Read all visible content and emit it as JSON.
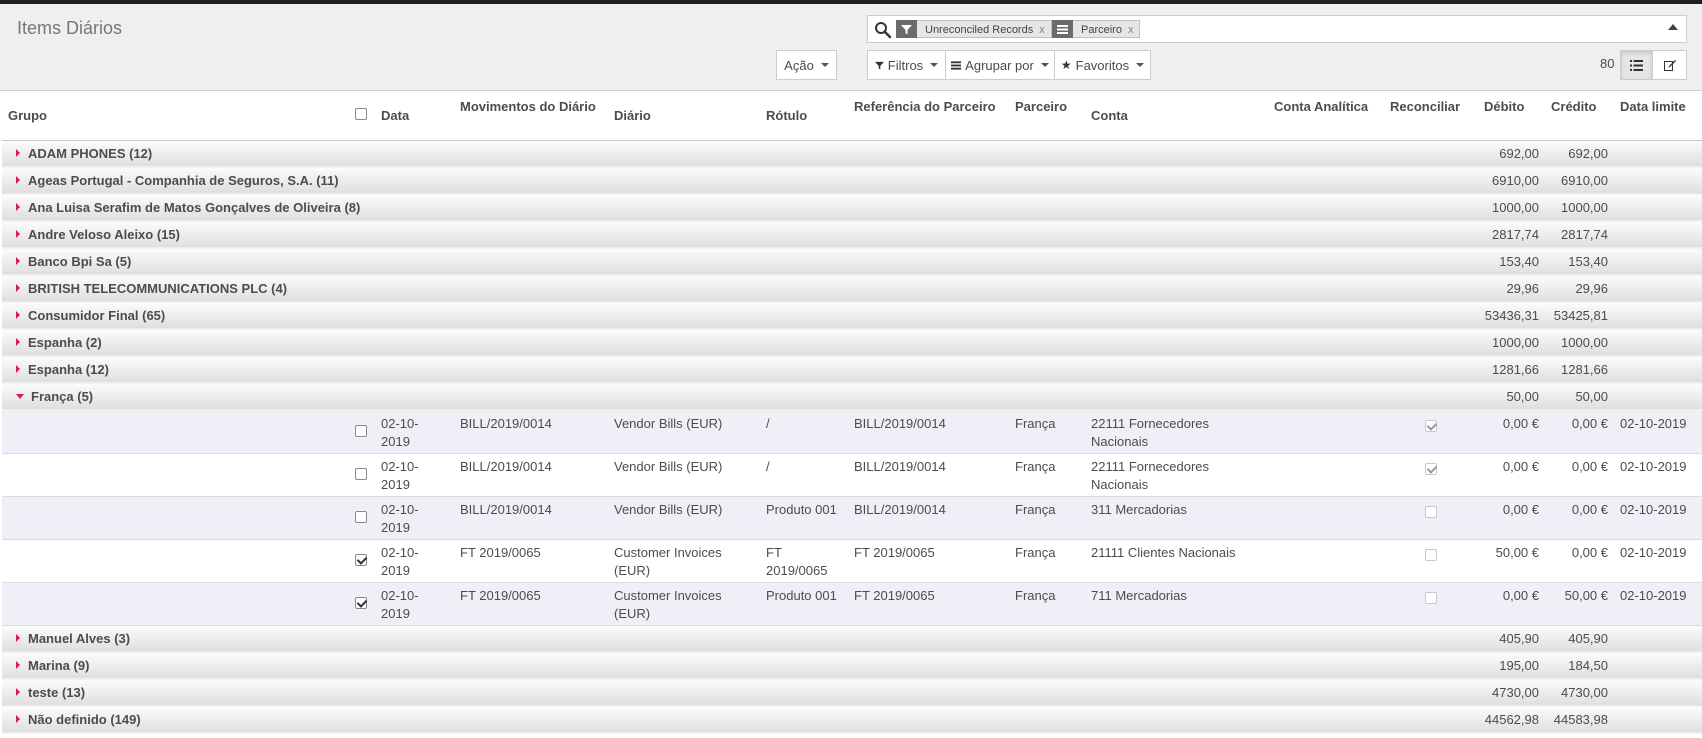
{
  "header": {
    "title": "Items Diários",
    "search": {
      "facets": [
        {
          "icon": "filter-icon",
          "value": "Unreconciled Records",
          "remove": "x"
        },
        {
          "icon": "group-by-icon",
          "value": "Parceiro",
          "remove": "x"
        }
      ]
    },
    "action_label": "Ação",
    "filters_label": "Filtros",
    "groupby_label": "Agrupar por",
    "favorites_label": "Favoritos",
    "pager_value": "80",
    "views": [
      "list-view-icon",
      "form-view-icon"
    ]
  },
  "table": {
    "columns": [
      "Grupo",
      "Data",
      "Movimentos do Diário",
      "Diário",
      "Rótulo",
      "Referência do Parceiro",
      "Parceiro",
      "Conta",
      "Conta Analítica",
      "Reconciliar",
      "Débito",
      "Crédito",
      "Data limite"
    ],
    "groups_before": [
      {
        "name": "ADAM PHONES (12)",
        "debit": "692,00",
        "credit": "692,00"
      },
      {
        "name": "Ageas Portugal - Companhia de Seguros, S.A. (11)",
        "debit": "6910,00",
        "credit": "6910,00"
      },
      {
        "name": "Ana Luisa Serafim de Matos Gonçalves de Oliveira (8)",
        "debit": "1000,00",
        "credit": "1000,00"
      },
      {
        "name": "Andre Veloso Aleixo (15)",
        "debit": "2817,74",
        "credit": "2817,74"
      },
      {
        "name": "Banco Bpi Sa (5)",
        "debit": "153,40",
        "credit": "153,40"
      },
      {
        "name": "BRITISH TELECOMMUNICATIONS PLC (4)",
        "debit": "29,96",
        "credit": "29,96"
      },
      {
        "name": "Consumidor Final (65)",
        "debit": "53436,31",
        "credit": "53425,81"
      },
      {
        "name": "Espanha (2)",
        "debit": "1000,00",
        "credit": "1000,00"
      },
      {
        "name": "Espanha (12)",
        "debit": "1281,66",
        "credit": "1281,66"
      }
    ],
    "open_group": {
      "name": "França (5)",
      "debit": "50,00",
      "credit": "50,00"
    },
    "rows": [
      {
        "selected": false,
        "date": "02-10-2019",
        "move": "BILL/2019/0014",
        "journal": "Vendor Bills (EUR)",
        "label": "/",
        "ref": "BILL/2019/0014",
        "partner": "França",
        "account": "22111 Fornecedores Nacionais",
        "analytic": "",
        "reconcile": true,
        "debit": "0,00 €",
        "credit": "0,00 €",
        "due": "02-10-2019"
      },
      {
        "selected": false,
        "date": "02-10-2019",
        "move": "BILL/2019/0014",
        "journal": "Vendor Bills (EUR)",
        "label": "/",
        "ref": "BILL/2019/0014",
        "partner": "França",
        "account": "22111 Fornecedores Nacionais",
        "analytic": "",
        "reconcile": true,
        "debit": "0,00 €",
        "credit": "0,00 €",
        "due": "02-10-2019"
      },
      {
        "selected": false,
        "date": "02-10-2019",
        "move": "BILL/2019/0014",
        "journal": "Vendor Bills (EUR)",
        "label": "Produto 001",
        "ref": "BILL/2019/0014",
        "partner": "França",
        "account": "311 Mercadorias",
        "analytic": "",
        "reconcile": false,
        "debit": "0,00 €",
        "credit": "0,00 €",
        "due": "02-10-2019"
      },
      {
        "selected": true,
        "date": "02-10-2019",
        "move": "FT 2019/0065",
        "journal": "Customer Invoices (EUR)",
        "label": "FT 2019/0065",
        "ref": "FT 2019/0065",
        "partner": "França",
        "account": "21111 Clientes Nacionais",
        "analytic": "",
        "reconcile": false,
        "debit": "50,00 €",
        "credit": "0,00 €",
        "due": "02-10-2019"
      },
      {
        "selected": true,
        "date": "02-10-2019",
        "move": "FT 2019/0065",
        "journal": "Customer Invoices (EUR)",
        "label": "Produto 001",
        "ref": "FT 2019/0065",
        "partner": "França",
        "account": "711 Mercadorias",
        "analytic": "",
        "reconcile": false,
        "debit": "0,00 €",
        "credit": "50,00 €",
        "due": "02-10-2019"
      }
    ],
    "groups_after": [
      {
        "name": "Manuel Alves (3)",
        "debit": "405,90",
        "credit": "405,90"
      },
      {
        "name": "Marina (9)",
        "debit": "195,00",
        "credit": "184,50"
      },
      {
        "name": "teste (13)",
        "debit": "4730,00",
        "credit": "4730,00"
      },
      {
        "name": "Não definido (149)",
        "debit": "44562,98",
        "credit": "44583,98"
      }
    ]
  },
  "colors": {
    "accent": "#d6166a",
    "row_highlight": "#efeff8",
    "facet_link": "#7c7bad"
  }
}
